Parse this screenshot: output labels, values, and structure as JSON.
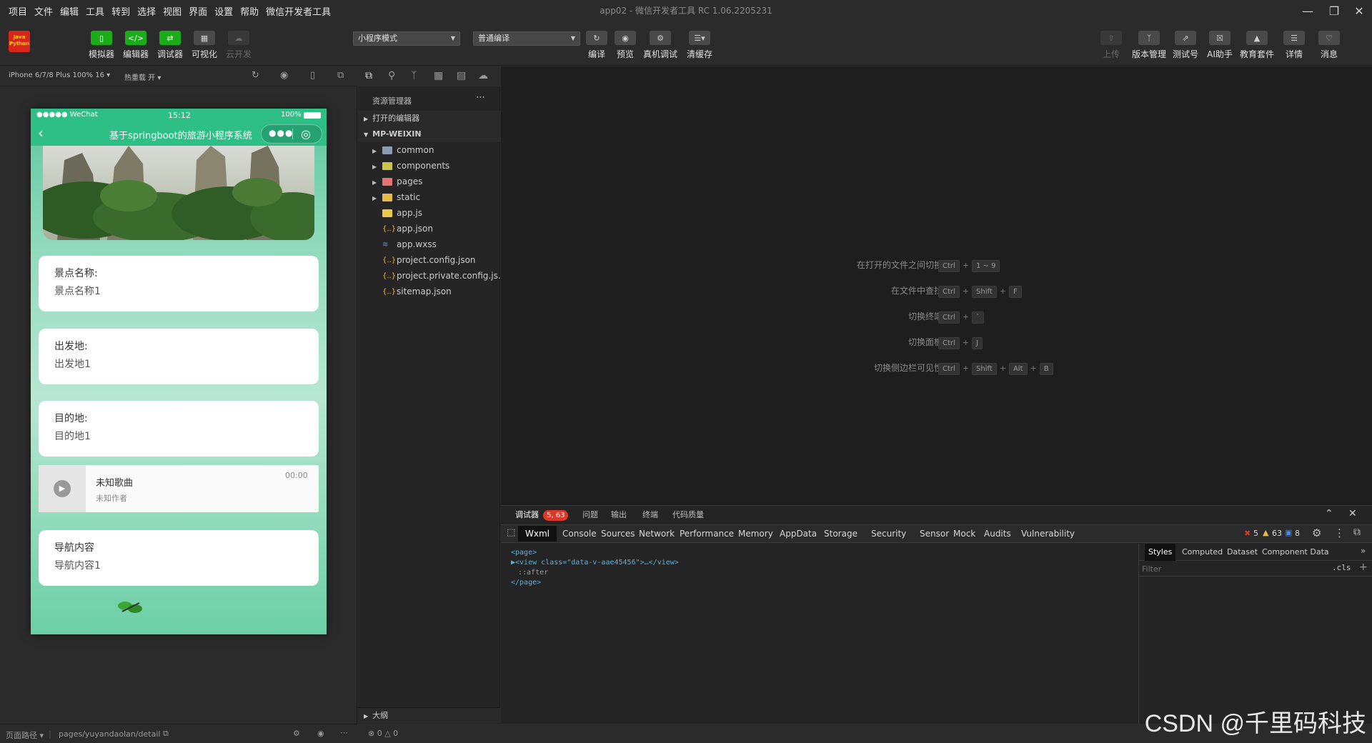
{
  "menu": [
    "项目",
    "文件",
    "编辑",
    "工具",
    "转到",
    "选择",
    "视图",
    "界面",
    "设置",
    "帮助",
    "微信开发者工具"
  ],
  "window_title": "app02 - 微信开发者工具 RC 1.06.2205231",
  "toolbar": {
    "left_buttons": [
      {
        "label": "模拟器",
        "icon": "phone-icon"
      },
      {
        "label": "编辑器",
        "icon": "code-icon"
      },
      {
        "label": "调试器",
        "icon": "debug-icon"
      },
      {
        "label": "可视化",
        "icon": "layout-icon"
      },
      {
        "label": "云开发",
        "icon": "cloud-icon"
      }
    ],
    "mode_select": "小程序模式",
    "compile_select": "普通编译",
    "center_buttons": [
      {
        "label": "编译",
        "icon": "refresh-icon"
      },
      {
        "label": "预览",
        "icon": "eye-icon"
      },
      {
        "label": "真机调试",
        "icon": "bug-icon"
      },
      {
        "label": "清缓存",
        "icon": "layers-icon"
      }
    ],
    "right_buttons": [
      {
        "label": "上传",
        "icon": "upload-icon"
      },
      {
        "label": "版本管理",
        "icon": "branch-icon"
      },
      {
        "label": "测试号",
        "icon": "external-icon"
      },
      {
        "label": "AI助手",
        "icon": "ai-icon"
      },
      {
        "label": "教育套件",
        "icon": "graduation-icon"
      },
      {
        "label": "详情",
        "icon": "menu-icon"
      },
      {
        "label": "消息",
        "icon": "bell-icon"
      }
    ]
  },
  "simulator": {
    "device": "iPhone 6/7/8 Plus 100% 16",
    "hot_reload": "热重载 开",
    "status_left": "●●●●● WeChat",
    "status_time": "15:12",
    "status_battery": "100%",
    "nav_title": "基于springboot的旅游小程序系统",
    "cards": [
      {
        "key": "景点名称:",
        "value": "景点名称1"
      },
      {
        "key": "出发地:",
        "value": "出发地1"
      },
      {
        "key": "目的地:",
        "value": "目的地1"
      }
    ],
    "audio": {
      "title": "未知歌曲",
      "author": "未知作者",
      "time": "00:00"
    },
    "nav_card": {
      "key": "导航内容",
      "value": "导航内容1"
    },
    "page_path_label": "页面路径",
    "page_path": "pages/yuyandaolan/detail"
  },
  "explorer": {
    "title": "资源管理器",
    "open_editors": "打开的编辑器",
    "project": "MP-WEIXIN",
    "items": [
      {
        "name": "common",
        "type": "folder",
        "color": "#8a9bb0"
      },
      {
        "name": "components",
        "type": "folder",
        "color": "#c9c44a"
      },
      {
        "name": "pages",
        "type": "folder",
        "color": "#e57373"
      },
      {
        "name": "static",
        "type": "folder",
        "color": "#e8b84a"
      },
      {
        "name": "app.js",
        "type": "js",
        "color": "#e8c84a"
      },
      {
        "name": "app.json",
        "type": "json",
        "color": "#e8b84a"
      },
      {
        "name": "app.wxss",
        "type": "wxss",
        "color": "#4a9be8"
      },
      {
        "name": "project.config.json",
        "type": "json",
        "color": "#e8b84a"
      },
      {
        "name": "project.private.config.js...",
        "type": "json",
        "color": "#e8b84a"
      },
      {
        "name": "sitemap.json",
        "type": "json",
        "color": "#e8b84a"
      }
    ],
    "outline": "大纲",
    "status_errors": "0",
    "status_warnings": "0"
  },
  "shortcuts": [
    {
      "name": "在打开的文件之间切换",
      "keys": [
        "Ctrl",
        "1 ~ 9"
      ]
    },
    {
      "name": "在文件中查找",
      "keys": [
        "Ctrl",
        "Shift",
        "F"
      ]
    },
    {
      "name": "切换终端",
      "keys": [
        "Ctrl",
        "`"
      ]
    },
    {
      "name": "切换面板",
      "keys": [
        "Ctrl",
        "J"
      ]
    },
    {
      "name": "切换侧边栏可见性",
      "keys": [
        "Ctrl",
        "Shift",
        "Alt",
        "B"
      ]
    }
  ],
  "devtools": {
    "tabs": [
      "调试器",
      "问题",
      "输出",
      "终端",
      "代码质量"
    ],
    "debugger_badge": "5, 63",
    "subtabs": [
      "Wxml",
      "Console",
      "Sources",
      "Network",
      "Performance",
      "Memory",
      "AppData",
      "Storage",
      "Security",
      "Sensor",
      "Mock",
      "Audits",
      "Vulnerability"
    ],
    "errors": "5",
    "warnings": "63",
    "infos": "8",
    "code_lines": [
      "<page>",
      "▶<view class=\"data-v-aae45456\">…</view>",
      "::after",
      "</page>"
    ],
    "side_tabs": [
      "Styles",
      "Computed",
      "Dataset",
      "Component Data"
    ],
    "filter_placeholder": "Filter",
    "cls": ".cls"
  },
  "watermark": "CSDN @千里码科技"
}
